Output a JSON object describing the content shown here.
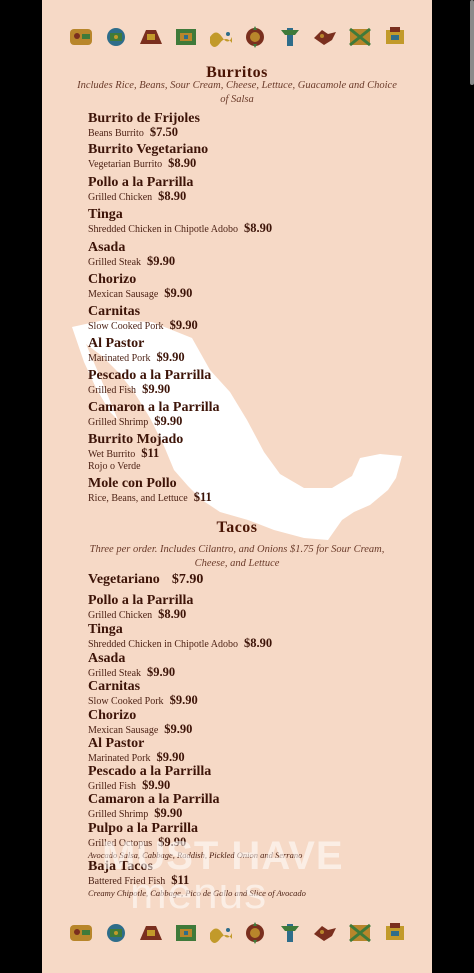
{
  "sections": {
    "burritos": {
      "title": "Burritos",
      "note": "Includes Rice, Beans, Sour Cream, Cheese, Lettuce, Guacamole and Choice of Salsa",
      "items": [
        {
          "name": "Burrito de Frijoles",
          "desc": "Beans Burrito",
          "price": "$7.50"
        },
        {
          "name": "Burrito Vegetariano",
          "desc": "Vegetarian Burrito",
          "price": "$8.90"
        },
        {
          "name": "Pollo a la Parrilla",
          "desc": "Grilled Chicken",
          "price": "$8.90"
        },
        {
          "name": "Tinga",
          "desc": "Shredded Chicken in Chipotle Adobo",
          "price": "$8.90"
        },
        {
          "name": "Asada",
          "desc": "Grilled Steak",
          "price": "$9.90"
        },
        {
          "name": "Chorizo",
          "desc": "Mexican Sausage",
          "price": "$9.90"
        },
        {
          "name": "Carnitas",
          "desc": "Slow Cooked Pork",
          "price": "$9.90"
        },
        {
          "name": "Al Pastor",
          "desc": "Marinated Pork",
          "price": "$9.90"
        },
        {
          "name": "Pescado a la Parrilla",
          "desc": "Grilled Fish",
          "price": "$9.90"
        },
        {
          "name": "Camaron a la Parrilla",
          "desc": "Grilled Shrimp",
          "price": "$9.90"
        },
        {
          "name": "Burrito Mojado",
          "desc": "Wet Burrito",
          "price": "$11",
          "extra": "Rojo o Verde"
        },
        {
          "name": "Mole con Pollo",
          "desc": "Rice, Beans, and Lettuce",
          "price": "$11"
        }
      ]
    },
    "tacos": {
      "title": "Tacos",
      "note": "Three per order. Includes Cilantro, and Onions $1.75 for Sour Cream, Cheese, and Lettuce",
      "items": [
        {
          "name": "Vegetariano",
          "price": "$7.90"
        },
        {
          "name": "Pollo a la Parrilla",
          "desc": "Grilled Chicken",
          "price": "$8.90"
        },
        {
          "name": "Tinga",
          "desc": "Shredded Chicken in Chipotle Adobo",
          "price": "$8.90"
        },
        {
          "name": "Asada",
          "desc": "Grilled Steak",
          "price": "$9.90"
        },
        {
          "name": "Carnitas",
          "desc": "Slow Cooked Pork",
          "price": "$9.90"
        },
        {
          "name": "Chorizo",
          "desc": "Mexican Sausage",
          "price": "$9.90"
        },
        {
          "name": "Al Pastor",
          "desc": "Marinated Pork",
          "price": "$9.90"
        },
        {
          "name": "Pescado a la Parrilla",
          "desc": "Grilled Fish",
          "price": "$9.90"
        },
        {
          "name": "Camaron a la Parrilla",
          "desc": "Grilled Shrimp",
          "price": "$9.90"
        },
        {
          "name": "Pulpo a la Parrilla",
          "desc": "Grilled Octopus",
          "price": "$9.90",
          "extra": "Avocado Salsa, Cabbage, Raddish, Pickled Onion and Serrano"
        },
        {
          "name": "Baja Tacos",
          "desc": "Battered Fried Fish",
          "price": "$11",
          "extra": "Creamy Chipotle, Cabbage, Pico de Gallo and Slice of Avocado"
        }
      ]
    }
  },
  "watermark": {
    "line1": "MUST HAVE",
    "line2": "menus"
  },
  "decor": {
    "icons": [
      "aztec-bird-icon",
      "aztec-mask-icon",
      "aztec-jaguar-icon",
      "aztec-glyph-icon",
      "aztec-serpent-icon",
      "aztec-sun-icon",
      "aztec-warrior-icon",
      "aztec-eagle-icon",
      "aztec-shield-icon",
      "aztec-deity-icon"
    ],
    "colors": {
      "background": "#f6d9c6",
      "text": "#3d1408",
      "map": "#ffffff"
    }
  }
}
